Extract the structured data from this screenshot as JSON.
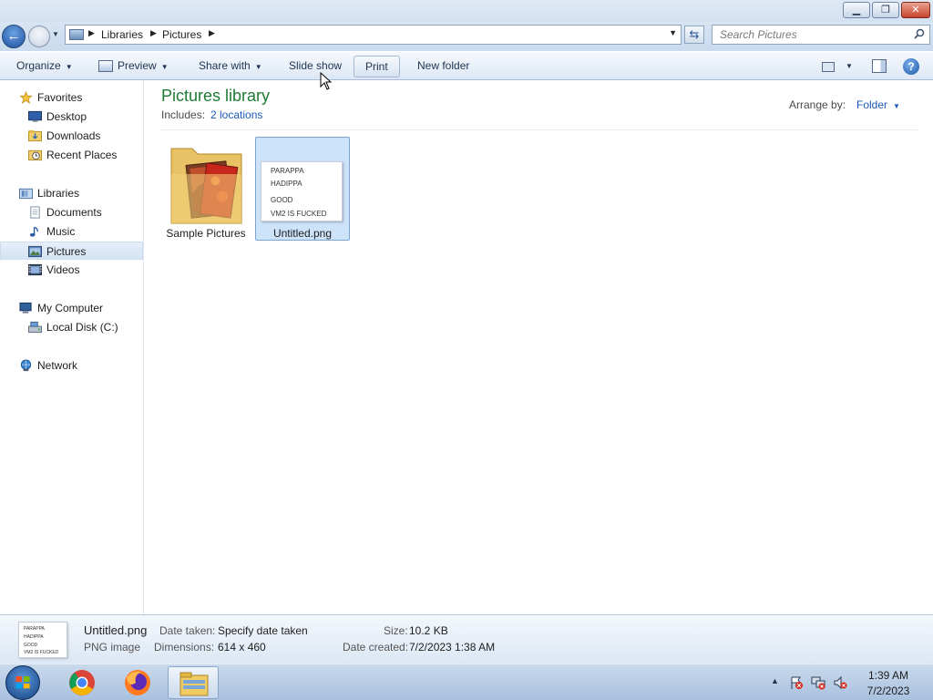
{
  "window": {
    "controls": {
      "minimize": "▁",
      "maximize": "❐",
      "close": "✕"
    }
  },
  "address_bar": {
    "breadcrumbs": [
      "Libraries",
      "Pictures"
    ],
    "search_placeholder": "Search Pictures"
  },
  "toolbar": {
    "organize": "Organize",
    "preview": "Preview",
    "share_with": "Share with",
    "slide_show": "Slide show",
    "print": "Print",
    "new_folder": "New folder",
    "help": "?"
  },
  "sidebar": {
    "items": [
      {
        "label": "Favorites",
        "icon": "star-icon"
      },
      {
        "label": "Desktop",
        "icon": "desktop-icon"
      },
      {
        "label": "Downloads",
        "icon": "downloads-folder-icon"
      },
      {
        "label": "Recent Places",
        "icon": "recent-places-icon"
      },
      {
        "label": "Libraries",
        "icon": "libraries-icon"
      },
      {
        "label": "Documents",
        "icon": "documents-icon"
      },
      {
        "label": "Music",
        "icon": "music-icon"
      },
      {
        "label": "Pictures",
        "icon": "pictures-icon",
        "selected": true
      },
      {
        "label": "Videos",
        "icon": "videos-icon"
      },
      {
        "label": "My Computer",
        "icon": "computer-icon"
      },
      {
        "label": "Local Disk (C:)",
        "icon": "local-disk-icon"
      },
      {
        "label": "Network",
        "icon": "network-icon"
      }
    ]
  },
  "library": {
    "title": "Pictures library",
    "includes_label": "Includes:",
    "includes_link": "2 locations",
    "arrange_label": "Arrange by:",
    "arrange_value": "Folder"
  },
  "files": [
    {
      "name": "Sample Pictures",
      "type": "folder"
    },
    {
      "name": "Untitled.png",
      "type": "image",
      "selected": true,
      "thumbnail_text": [
        "PARAPPA",
        "HADIPPA",
        "GOOD",
        "VM2 IS FUCKED"
      ]
    }
  ],
  "details": {
    "name": "Untitled.png",
    "type": "PNG image",
    "date_taken_label": "Date taken:",
    "date_taken_value": "Specify date taken",
    "dimensions_label": "Dimensions:",
    "dimensions_value": "614 x 460",
    "size_label": "Size:",
    "size_value": "10.2 KB",
    "date_created_label": "Date created:",
    "date_created_value": "7/2/2023 1:38 AM"
  },
  "taskbar": {
    "apps": [
      "chrome-icon",
      "firefox-icon",
      "explorer-icon"
    ],
    "clock_time": "1:39 AM",
    "clock_date": "7/2/2023"
  },
  "colors": {
    "library_title": "#1e7b34",
    "link": "#1a5bb8",
    "selection": "#cde3f9"
  }
}
